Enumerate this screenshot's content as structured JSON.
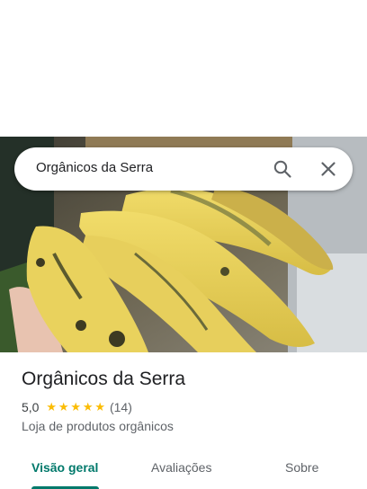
{
  "search": {
    "query": "Orgânicos da Serra",
    "search_icon": "search-icon",
    "close_icon": "close-icon"
  },
  "photo": {
    "subject": "bananas-photo"
  },
  "place": {
    "name": "Orgânicos da Serra",
    "rating": "5,0",
    "stars": 5,
    "review_count": "(14)",
    "category": "Loja de produtos orgânicos"
  },
  "tabs": [
    {
      "label": "Visão geral",
      "active": true
    },
    {
      "label": "Avaliações",
      "active": false
    },
    {
      "label": "Sobre",
      "active": false
    }
  ],
  "colors": {
    "accent": "#00796b",
    "star": "#fbbc04",
    "text_primary": "#202124",
    "text_secondary": "#5f6368"
  }
}
